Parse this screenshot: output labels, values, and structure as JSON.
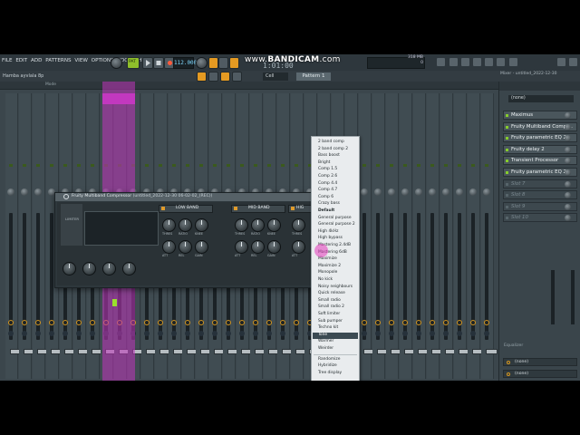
{
  "menu": [
    "FILE",
    "EDIT",
    "ADD",
    "PATTERNS",
    "VIEW",
    "OPTIONS",
    "TOOLS",
    "HELP"
  ],
  "transport": {
    "pat_label": "PAT",
    "tempo": "112.000"
  },
  "watermark": {
    "prefix": "www.",
    "brand": "BANDICAM",
    "suffix": ".com"
  },
  "time_display": "1:01:00",
  "cpu": {
    "line1": "318 MB",
    "line2": "0"
  },
  "hint_text": "Hamba ayvlala 8p",
  "snap_value": "Cell",
  "pattern_name": "Pattern 1",
  "mixer_title": "Mixer - untitled_2022-12-30",
  "mixer_ruler_label": "Mode",
  "plugin": {
    "title": "Fruity Multiband Compressor",
    "subtitle": "(untitled_2022-12-30 06-02-02_(REC))",
    "limiter_label": "LIMITER",
    "bands": [
      "LOW BAND",
      "MID BAND",
      "HIG"
    ],
    "knob_labels": [
      "THRES",
      "RATIO",
      "KNEE",
      "ATT",
      "REL",
      "GAIN"
    ]
  },
  "presets": [
    "2 band comp",
    "2 band comp 2",
    "Bass boost",
    "Bright",
    "Comp 1.5",
    "Comp 2.6",
    "Comp 4.4",
    "Comp 4.7",
    "Comp 6",
    "Crazy bass",
    "Default",
    "General purpose",
    "General purpose 2",
    "High 4kHz",
    "High bypass",
    "Mastering 2.4dB",
    "Mastering 6dB",
    "Maximize",
    "Maximize 2",
    "Monopole",
    "No kick",
    "Noisy neighbours",
    "Quick release",
    "Small radio",
    "Small radio 2",
    "Soft limiter",
    "Sub pumper",
    "Techno kit",
    "Tone",
    "Warmer",
    "Weirder",
    "Randomize",
    "Hybridize",
    "Tree display"
  ],
  "right_panel": {
    "input": "(none)",
    "slots": [
      {
        "name": "Maximus",
        "empty": false
      },
      {
        "name": "Fruity Multiband Compr...",
        "empty": false
      },
      {
        "name": "Fruity parametric EQ 2",
        "empty": false
      },
      {
        "name": "Fruity delay 2",
        "empty": false
      },
      {
        "name": "Transient Processor",
        "empty": false
      },
      {
        "name": "Fruity parametric EQ 2",
        "empty": false
      },
      {
        "name": "Slot 7",
        "empty": true
      },
      {
        "name": "Slot 8",
        "empty": true
      },
      {
        "name": "Slot 9",
        "empty": true
      },
      {
        "name": "Slot 10",
        "empty": true
      }
    ],
    "equalizer_label": "Equalizer",
    "output_1": "(none)",
    "output_2": "(none)"
  },
  "colors": {
    "accent_pink": "#c238bf",
    "accent_orange": "#e49a22",
    "accent_green": "#8fbf2b"
  },
  "icons": [
    "gear-icon",
    "record-icon",
    "play-icon",
    "stop-icon",
    "menu-arrow-icon",
    "mixer-icon",
    "piano-icon",
    "playlist-icon"
  ]
}
